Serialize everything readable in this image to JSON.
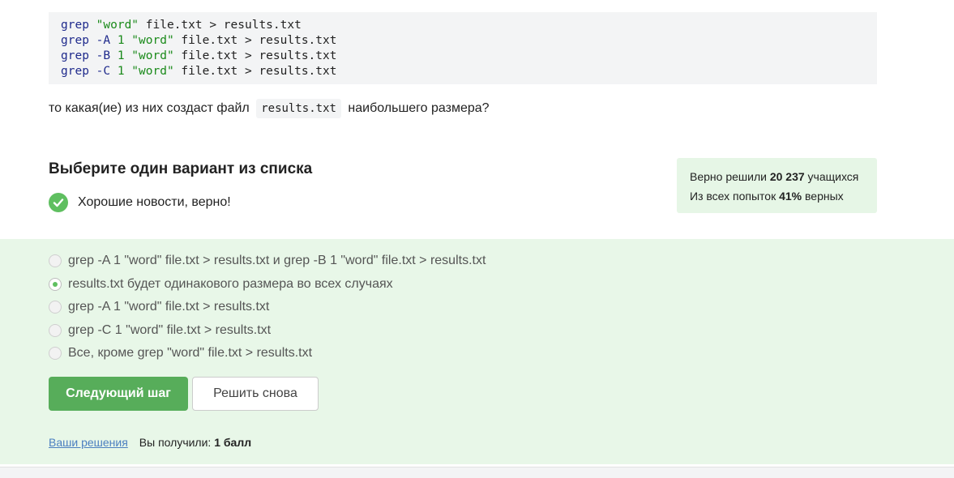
{
  "code_lines": [
    {
      "cmd": "grep",
      "flag": "",
      "num": "",
      "pattern": "\"word\"",
      "rest": " file.txt > results.txt"
    },
    {
      "cmd": "grep",
      "flag": " -A ",
      "num": "1",
      "pattern": " \"word\"",
      "rest": " file.txt > results.txt"
    },
    {
      "cmd": "grep",
      "flag": " -B ",
      "num": "1",
      "pattern": " \"word\"",
      "rest": " file.txt > results.txt"
    },
    {
      "cmd": "grep",
      "flag": " -C ",
      "num": "1",
      "pattern": " \"word\"",
      "rest": " file.txt > results.txt"
    }
  ],
  "question": {
    "before": "то какая(ие) из них создаст файл",
    "code": "results.txt",
    "after": "наибольшего размера?"
  },
  "section_title": "Выберите один вариант из списка",
  "status_text": "Хорошие новости, верно!",
  "stats": {
    "line1_prefix": "Верно решили",
    "line1_value": "20 237",
    "line1_suffix": "учащихся",
    "line2_prefix": "Из всех попыток",
    "line2_value": "41%",
    "line2_suffix": "верных"
  },
  "options": [
    {
      "label": "grep -A 1 \"word\" file.txt > results.txt и grep -B 1 \"word\" file.txt > results.txt",
      "selected": false
    },
    {
      "label": "results.txt будет одинакового размера во всех случаях",
      "selected": true
    },
    {
      "label": "grep -A 1 \"word\" file.txt > results.txt",
      "selected": false
    },
    {
      "label": "grep -C 1 \"word\" file.txt > results.txt",
      "selected": false
    },
    {
      "label": "Все, кроме grep \"word\" file.txt > results.txt",
      "selected": false
    }
  ],
  "buttons": {
    "next_step": "Следующий шаг",
    "solve_again": "Решить снова"
  },
  "footer": {
    "solutions_link": "Ваши решения",
    "score_prefix": "Вы получили:",
    "score_value": "1 балл"
  },
  "colors": {
    "accent_green": "#57ad5a",
    "answers_bg": "#e8f7e8",
    "link": "#4b7fc0"
  }
}
